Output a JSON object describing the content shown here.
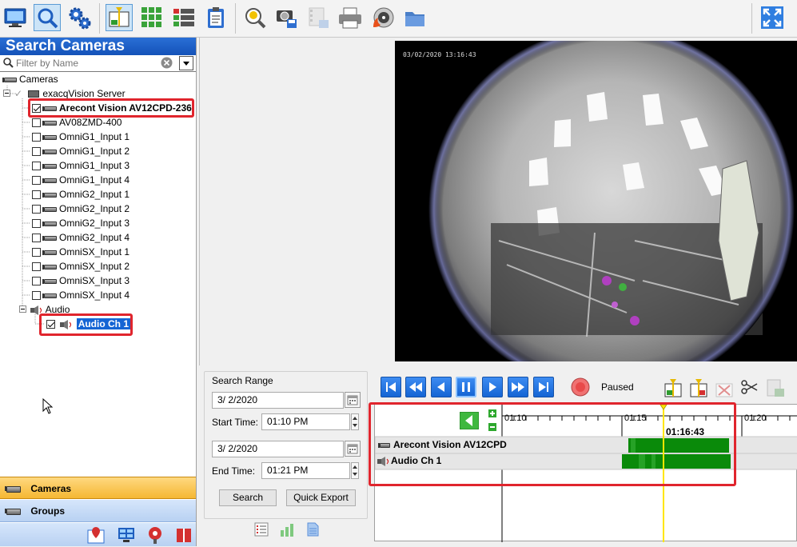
{
  "sidebar": {
    "title": "Search Cameras",
    "filter_placeholder": "Filter by Name",
    "tree": {
      "root": "Cameras",
      "server": "exacqVision Server",
      "cameras": [
        {
          "name": "Arecont Vision AV12CPD-236",
          "checked": true,
          "bold": true
        },
        {
          "name": "AV08ZMD-400",
          "checked": false
        },
        {
          "name": "OmniG1_Input 1",
          "checked": false
        },
        {
          "name": "OmniG1_Input 2",
          "checked": false
        },
        {
          "name": "OmniG1_Input 3",
          "checked": false
        },
        {
          "name": "OmniG1_Input 4",
          "checked": false
        },
        {
          "name": "OmniG2_Input 1",
          "checked": false
        },
        {
          "name": "OmniG2_Input 2",
          "checked": false
        },
        {
          "name": "OmniG2_Input 3",
          "checked": false
        },
        {
          "name": "OmniG2_Input 4",
          "checked": false
        },
        {
          "name": "OmniSX_Input 1",
          "checked": false
        },
        {
          "name": "OmniSX_Input 2",
          "checked": false
        },
        {
          "name": "OmniSX_Input 3",
          "checked": false
        },
        {
          "name": "OmniSX_Input 4",
          "checked": false
        }
      ],
      "audio_group": "Audio",
      "audio_item": {
        "name": "Audio Ch 1",
        "checked": true
      }
    },
    "nav": {
      "cameras": "Cameras",
      "groups": "Groups"
    }
  },
  "video": {
    "overlay_timestamp": "03/02/2020 13:16:43"
  },
  "search_range": {
    "title": "Search Range",
    "start_date": "3/ 2/2020",
    "start_time_label": "Start Time:",
    "start_time": "01:10 PM",
    "end_date": "3/ 2/2020",
    "end_time_label": "End Time:",
    "end_time": "01:21 PM",
    "search_button": "Search",
    "quick_export_button": "Quick Export"
  },
  "playback": {
    "status": "Paused"
  },
  "timeline": {
    "ticks": [
      "01:10",
      "01:15",
      "01:20"
    ],
    "cursor_time": "01:16:43",
    "tracks": [
      {
        "name": "Arecont Vision AV12CPD",
        "type": "camera"
      },
      {
        "name": "Audio Ch 1",
        "type": "audio"
      }
    ]
  },
  "colors": {
    "accent": "#1565d4",
    "highlight": "#e0252d",
    "recording": "#0a8a0a",
    "cursor": "#ffe600"
  }
}
